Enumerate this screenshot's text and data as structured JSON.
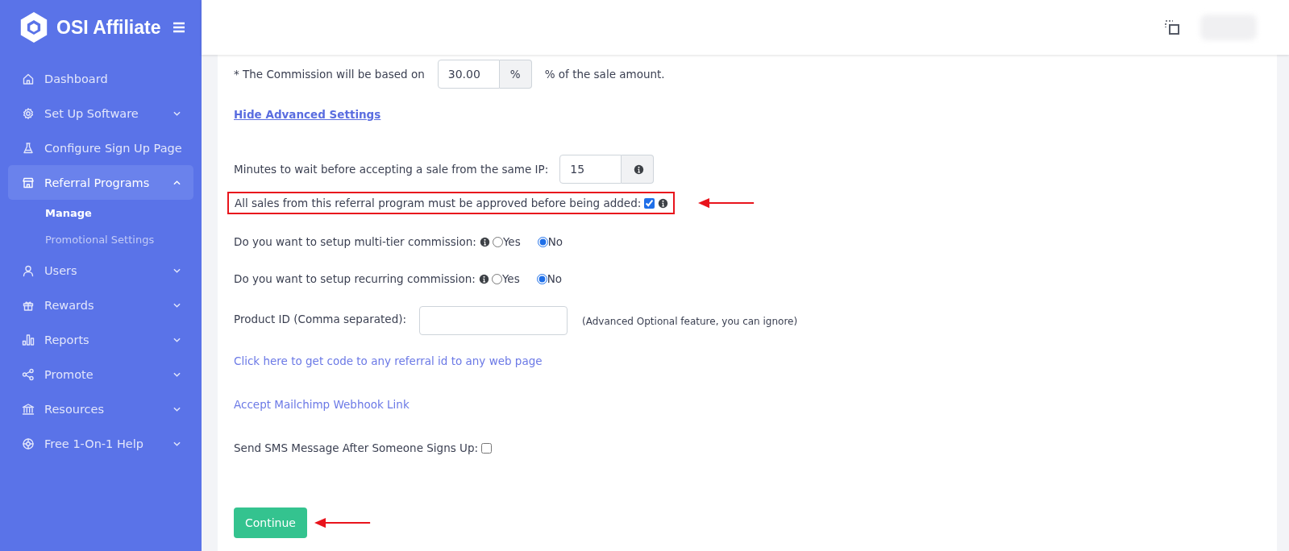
{
  "brand": {
    "name": "OSI Affiliate"
  },
  "sidebar": {
    "items": [
      {
        "label": "Dashboard",
        "kind": "link",
        "selected": false
      },
      {
        "label": "Set Up Software",
        "kind": "menu",
        "expanded": false,
        "selected": false
      },
      {
        "label": "Configure Sign Up Page",
        "kind": "link",
        "selected": false
      },
      {
        "label": "Referral Programs",
        "kind": "menu",
        "expanded": true,
        "selected": true,
        "children": [
          {
            "label": "Manage",
            "selected": true
          },
          {
            "label": "Promotional Settings",
            "selected": false
          }
        ]
      },
      {
        "label": "Users",
        "kind": "menu",
        "expanded": false,
        "selected": false
      },
      {
        "label": "Rewards",
        "kind": "menu",
        "expanded": false,
        "selected": false
      },
      {
        "label": "Reports",
        "kind": "menu",
        "expanded": false,
        "selected": false
      },
      {
        "label": "Promote",
        "kind": "menu",
        "expanded": false,
        "selected": false
      },
      {
        "label": "Resources",
        "kind": "menu",
        "expanded": false,
        "selected": false
      },
      {
        "label": "Free 1-On-1 Help",
        "kind": "menu",
        "expanded": false,
        "selected": false
      }
    ]
  },
  "form": {
    "commission": {
      "label": "* The Commission will be based on",
      "value": "30.00",
      "unit": "%",
      "suffix": "% of the sale amount."
    },
    "advanced_link": "Hide Advanced Settings",
    "wait_minutes": {
      "label": "Minutes to wait before accepting a sale from the same IP:",
      "value": "15"
    },
    "approval": {
      "label": "All sales from this referral program must be approved before being added:",
      "checked": true,
      "highlighted": true
    },
    "questions": [
      {
        "label": "Do you want to setup multi-tier commission:",
        "options": [
          {
            "label": "Yes",
            "selected": false
          },
          {
            "label": "No",
            "selected": true
          }
        ]
      },
      {
        "label": "Do you want to setup recurring commission:",
        "options": [
          {
            "label": "Yes",
            "selected": false
          },
          {
            "label": "No",
            "selected": true
          }
        ]
      }
    ],
    "product_id": {
      "label": "Product ID (Comma separated):",
      "note": "(Advanced Optional feature, you can ignore)"
    },
    "links": [
      "Click here to get code to any referral id to any web page",
      "Accept Mailchimp Webhook Link"
    ],
    "sms": {
      "label": "Send SMS Message After Someone Signs Up:",
      "checked": false
    },
    "continue_button": {
      "label": "Continue",
      "highlighted": true
    }
  }
}
